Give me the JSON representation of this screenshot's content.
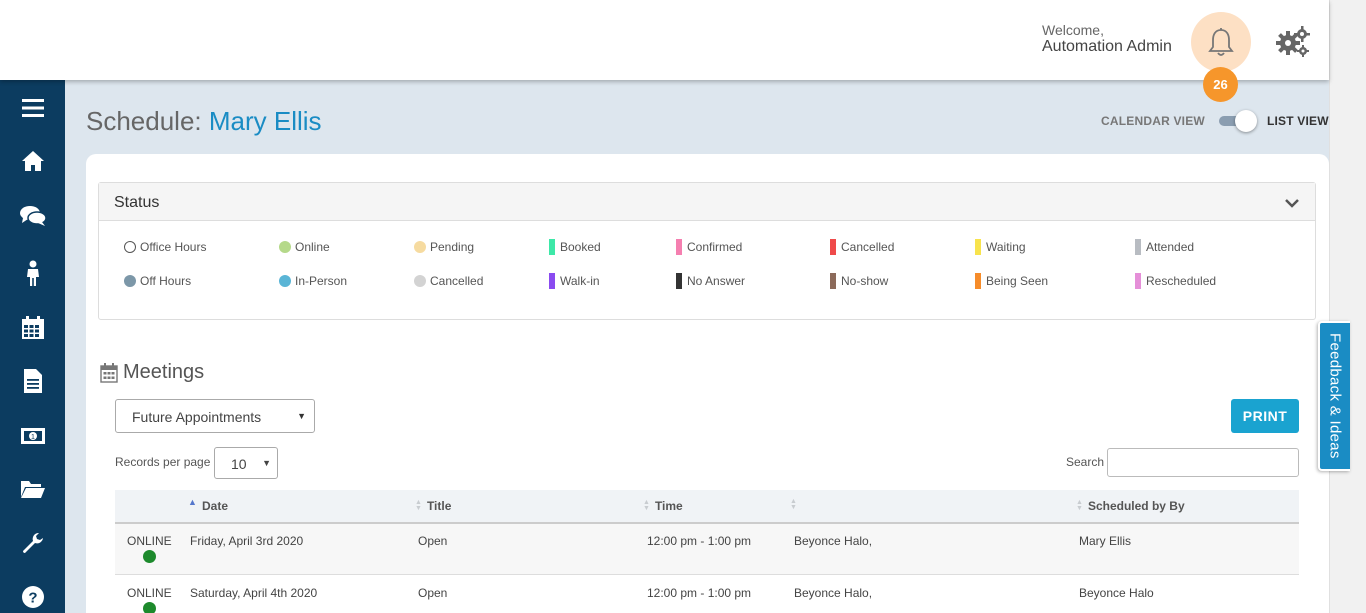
{
  "header": {
    "welcome": "Welcome,",
    "user_name": "Automation Admin",
    "notification_count": "26"
  },
  "sidebar": {
    "items": [
      "menu-icon",
      "home-icon",
      "chat-icon",
      "person-icon",
      "calendar-icon",
      "document-icon",
      "money-icon",
      "folder-icon",
      "wrench-icon",
      "help-icon"
    ]
  },
  "page": {
    "title_prefix": "Schedule:",
    "title_name": "Mary Ellis",
    "calendar_view_label": "CALENDAR VIEW",
    "list_view_label": "LIST VIEW"
  },
  "status": {
    "title": "Status",
    "legend": [
      {
        "label": "Office Hours",
        "kind": "dot-outline",
        "color": "#ffffff"
      },
      {
        "label": "Online",
        "kind": "dot",
        "color": "#b5d98a"
      },
      {
        "label": "Pending",
        "kind": "dot",
        "color": "#f6dba0"
      },
      {
        "label": "Booked",
        "kind": "bar",
        "color": "#3de8a8"
      },
      {
        "label": "Confirmed",
        "kind": "bar",
        "color": "#f57fb0"
      },
      {
        "label": "Cancelled",
        "kind": "bar",
        "color": "#ef4a4a"
      },
      {
        "label": "Waiting",
        "kind": "bar",
        "color": "#f8e34c"
      },
      {
        "label": "Attended",
        "kind": "bar",
        "color": "#b8bcc2"
      },
      {
        "label": "Off Hours",
        "kind": "dot",
        "color": "#7c97a8"
      },
      {
        "label": "In-Person",
        "kind": "dot",
        "color": "#5ab5d6"
      },
      {
        "label": "Cancelled",
        "kind": "dot",
        "color": "#d3d3d3"
      },
      {
        "label": "Walk-in",
        "kind": "bar",
        "color": "#8a4bf0"
      },
      {
        "label": "No Answer",
        "kind": "bar",
        "color": "#333333"
      },
      {
        "label": "No-show",
        "kind": "bar",
        "color": "#8c6a5a"
      },
      {
        "label": "Being Seen",
        "kind": "bar",
        "color": "#f68c2a"
      },
      {
        "label": "Rescheduled",
        "kind": "bar",
        "color": "#e58fd8"
      }
    ]
  },
  "meetings": {
    "title": "Meetings",
    "filter_value": "Future Appointments",
    "print_label": "PRINT",
    "records_per_page_label": "Records per page",
    "records_per_page_value": "10",
    "search_label": "Search",
    "columns": [
      "Date",
      "Title",
      "Time",
      "",
      "Scheduled by By"
    ],
    "rows": [
      {
        "type": "ONLINE",
        "date": "Friday, April 3rd 2020",
        "title": "Open",
        "time": "12:00 pm - 1:00 pm",
        "attendee": "Beyonce Halo,",
        "scheduled_by": "Mary Ellis"
      },
      {
        "type": "ONLINE",
        "date": "Saturday, April 4th 2020",
        "title": "Open",
        "time": "12:00 pm - 1:00 pm",
        "attendee": "Beyonce Halo,",
        "scheduled_by": "Beyonce Halo"
      }
    ]
  },
  "feedback": {
    "label": "Feedback & Ideas"
  }
}
